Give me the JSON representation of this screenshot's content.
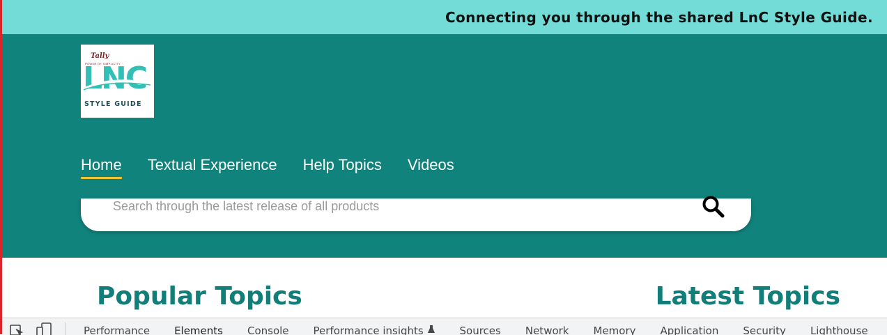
{
  "banner": {
    "text": "Connecting you through the shared LnC Style Guide."
  },
  "logo": {
    "brand": "Tally",
    "tagline": "POWER OF SIMPLICITY",
    "wordmark": "LNC",
    "subtitle": "STYLE GUIDE"
  },
  "nav": {
    "items": [
      {
        "label": "Home",
        "active": true
      },
      {
        "label": "Textual Experience",
        "active": false
      },
      {
        "label": "Help Topics",
        "active": false
      },
      {
        "label": "Videos",
        "active": false
      }
    ]
  },
  "search": {
    "placeholder": "Search through the latest release of all products",
    "value": "",
    "icon": "search-icon"
  },
  "sections": {
    "popular_title": "Popular Topics",
    "latest_title": "Latest Topics"
  },
  "devtools": {
    "tabs": [
      "Performance",
      "Elements",
      "Console",
      "Performance insights",
      "Sources",
      "Network",
      "Memory",
      "Application",
      "Security",
      "Lighthouse"
    ],
    "selected": "Elements"
  },
  "colors": {
    "banner_bg": "#74dcd6",
    "hero_bg": "#11837d",
    "accent_underline": "#f2c530",
    "heading": "#127e79"
  }
}
